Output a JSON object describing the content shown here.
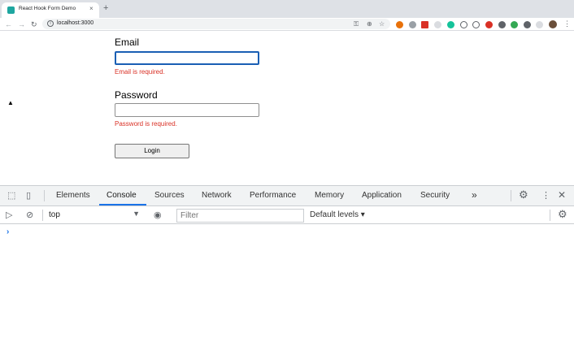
{
  "browser": {
    "tab_title": "React Hook Form Demo",
    "tab_close": "×",
    "new_tab": "+",
    "url": "localhost:3000",
    "nav": {
      "back": "←",
      "forward": "→",
      "reload": "↻"
    },
    "info": "i",
    "omnibox_icons": [
      "key-icon",
      "zoom-icon",
      "star-icon"
    ],
    "extension_colors": [
      "#e8710a",
      "#5f6368",
      "#d93025",
      "#9aa0a6",
      "#15c39a",
      "#5f6368",
      "#5f6368",
      "#d93025",
      "#d93025",
      "#4285f4",
      "#5f6368",
      "#9aa0a6"
    ],
    "menu": "⋮"
  },
  "form": {
    "email_label": "Email",
    "email_value": "",
    "email_error": "Email is required.",
    "password_label": "Password",
    "password_value": "",
    "password_error": "Password is required.",
    "login_label": "Login"
  },
  "devtools": {
    "tabs": [
      "Elements",
      "Console",
      "Sources",
      "Network",
      "Performance",
      "Memory",
      "Application",
      "Security"
    ],
    "active_tab": "Console",
    "more": "»",
    "context": "top",
    "filter_placeholder": "Filter",
    "levels": "Default levels ▾",
    "prompt": "›",
    "accent": "#1a73e8"
  },
  "colors": {
    "error": "#d93025",
    "focus": "#1a5fb4"
  }
}
